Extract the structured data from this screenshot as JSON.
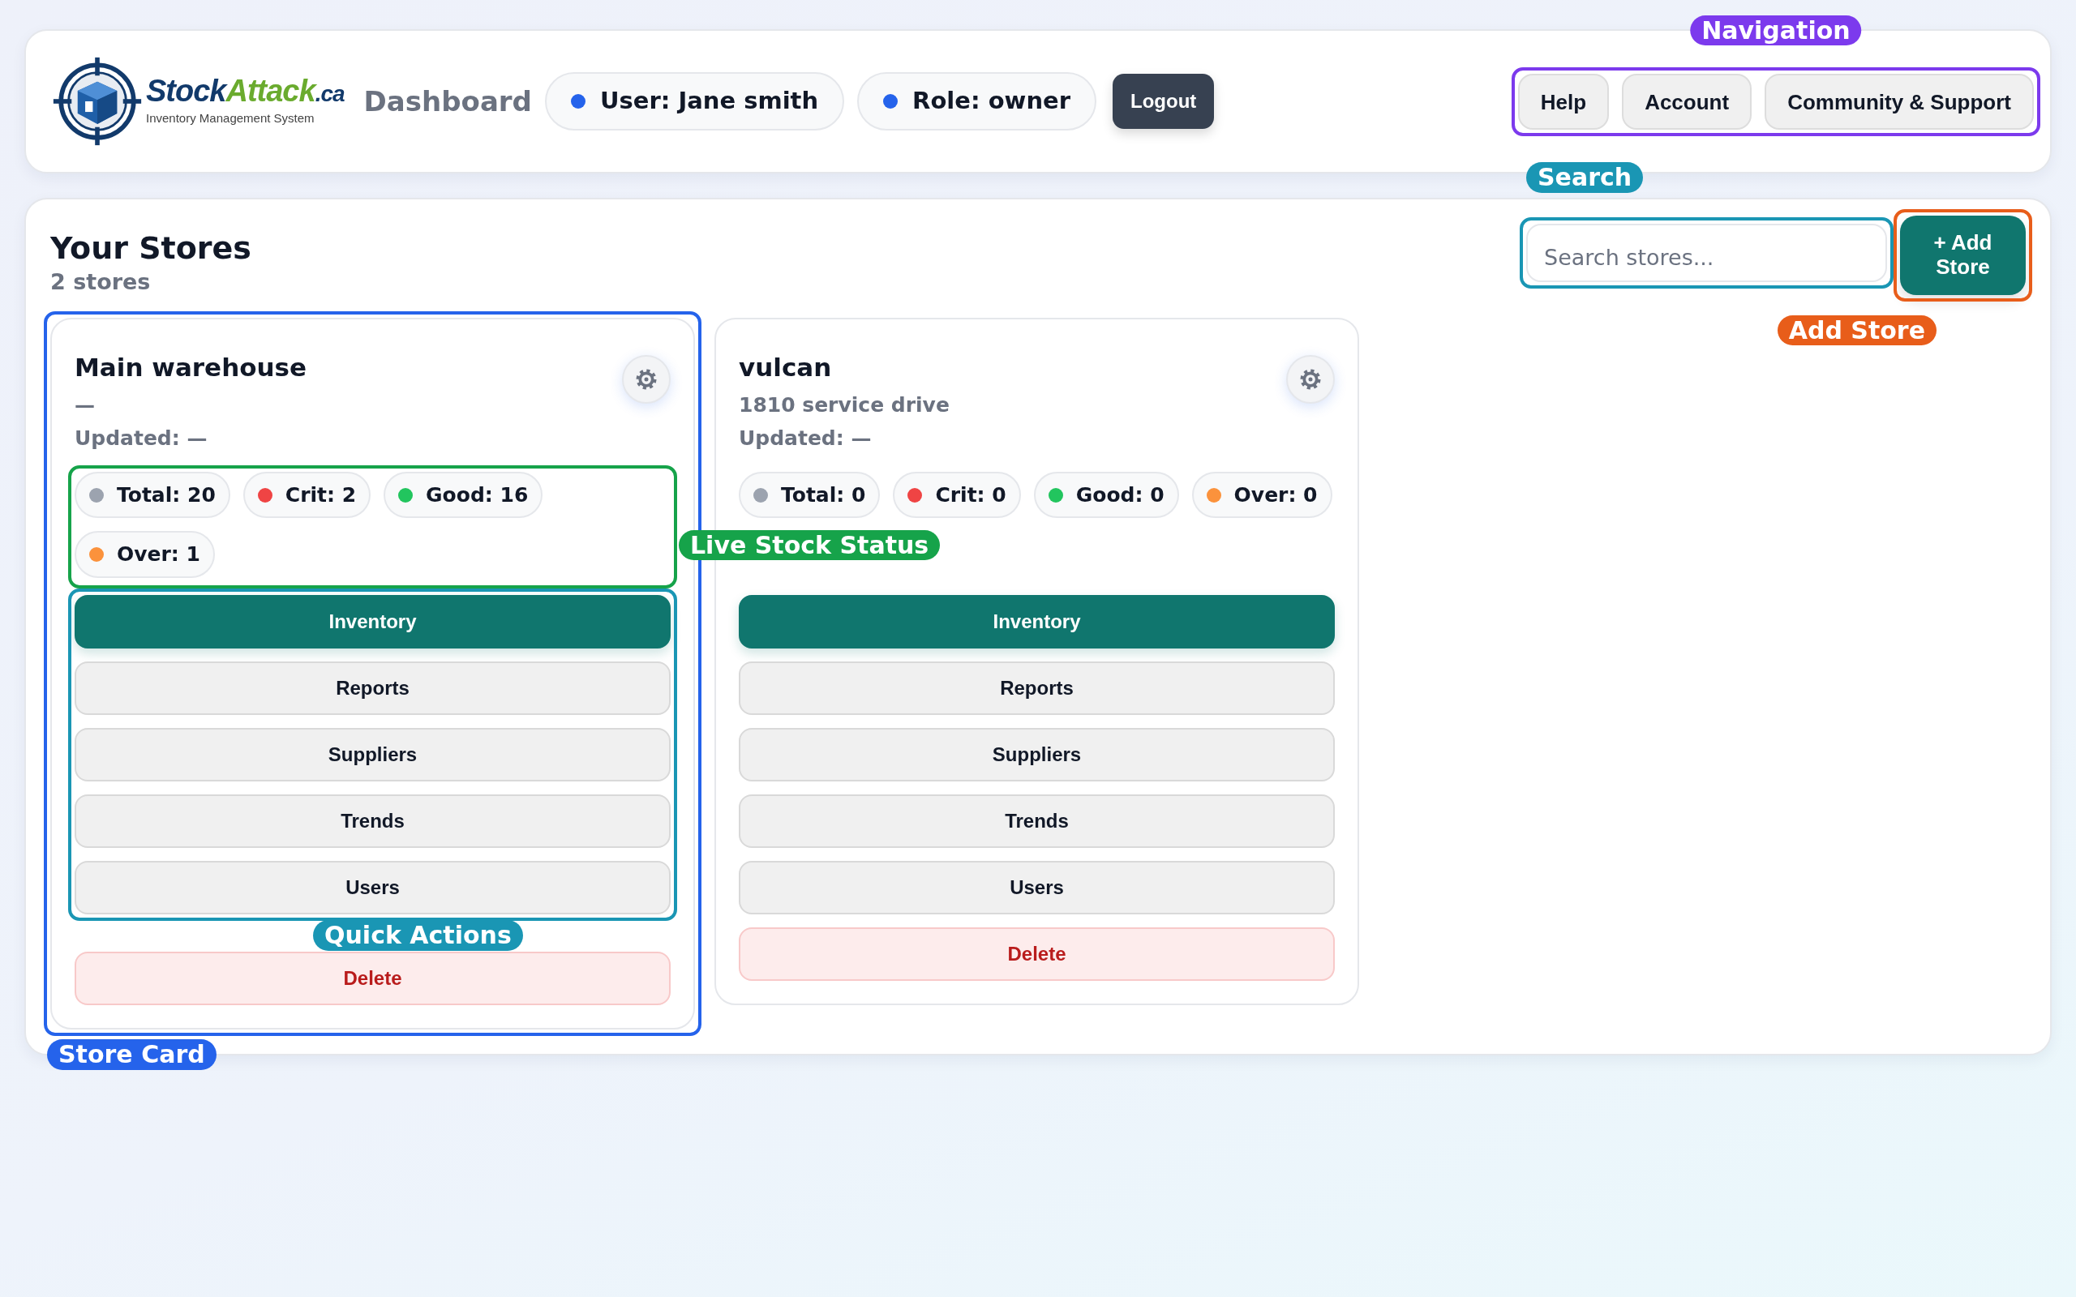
{
  "header": {
    "brand": {
      "name": "Stock",
      "accent": "Attack",
      "suffix": ".ca",
      "tagline": "Inventory Management System"
    },
    "title": "Dashboard",
    "pills": [
      {
        "text": "User: Jane smith"
      },
      {
        "text": "Role: owner"
      }
    ],
    "logout": "Logout",
    "nav": {
      "items": [
        "Help",
        "Account",
        "Community & Support"
      ],
      "annotation": {
        "label": "Navigation",
        "color": "#7c3aed"
      }
    }
  },
  "stores_panel": {
    "title": "Your Stores",
    "count": "2 stores",
    "search": {
      "placeholder": "Search stores...",
      "annotation": {
        "label": "Search",
        "color": "#1a96b4"
      }
    },
    "add_button": {
      "label": "+ Add Store",
      "annotation": {
        "label": "Add Store",
        "color": "#e85d1a"
      }
    },
    "stores": [
      {
        "name": "Main warehouse",
        "address": "—",
        "updated": "Updated: —",
        "stats": [
          {
            "text": "Total: 20",
            "color": "#9ca3af"
          },
          {
            "text": "Crit: 2",
            "color": "#ef4444"
          },
          {
            "text": "Good: 16",
            "color": "#22c55e"
          },
          {
            "text": "Over: 1",
            "color": "#fb923c"
          }
        ],
        "stats_annotation": {
          "label": "Live Stock Status",
          "color": "#16a34a"
        },
        "actions": [
          {
            "label": "Inventory",
            "kind": "primary"
          },
          {
            "label": "Reports",
            "kind": "default"
          },
          {
            "label": "Suppliers",
            "kind": "default"
          },
          {
            "label": "Trends",
            "kind": "default"
          },
          {
            "label": "Users",
            "kind": "default"
          },
          {
            "label": "Delete",
            "kind": "danger"
          }
        ],
        "actions_annotation": {
          "label": "Quick Actions",
          "color": "#1a96b4"
        },
        "annotation": {
          "label": "Store Card",
          "color": "#2563eb"
        }
      },
      {
        "name": "vulcan",
        "address": "1810 service drive",
        "updated": "Updated: —",
        "stats": [
          {
            "text": "Total: 0",
            "color": "#9ca3af"
          },
          {
            "text": "Crit: 0",
            "color": "#ef4444"
          },
          {
            "text": "Good: 0",
            "color": "#22c55e"
          },
          {
            "text": "Over: 0",
            "color": "#fb923c"
          }
        ],
        "actions": [
          {
            "label": "Inventory",
            "kind": "primary"
          },
          {
            "label": "Reports",
            "kind": "default"
          },
          {
            "label": "Suppliers",
            "kind": "default"
          },
          {
            "label": "Trends",
            "kind": "default"
          },
          {
            "label": "Users",
            "kind": "default"
          },
          {
            "label": "Delete",
            "kind": "danger"
          }
        ]
      }
    ]
  }
}
